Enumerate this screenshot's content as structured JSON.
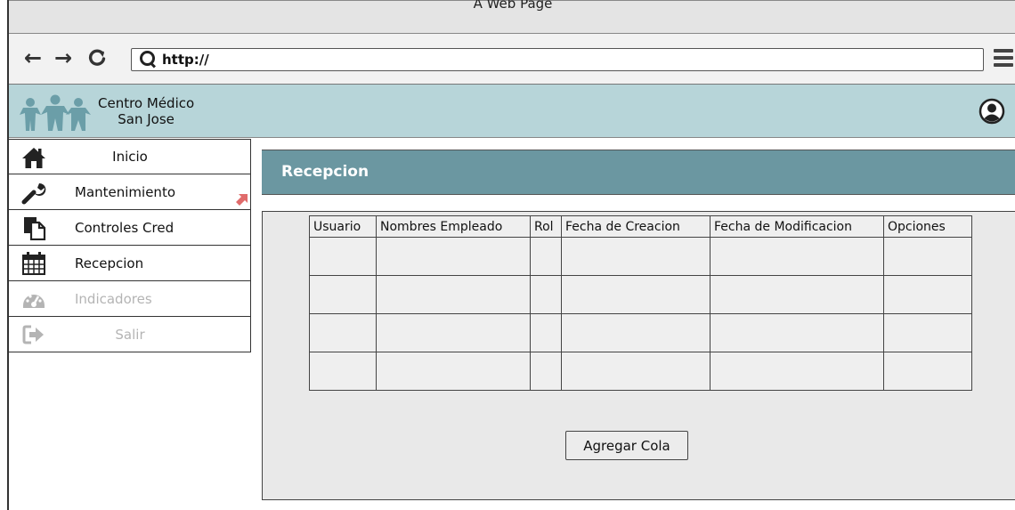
{
  "window": {
    "title": "A Web Page"
  },
  "addressbar": {
    "url": "http://",
    "icons": {
      "back": "back-arrow-icon",
      "forward": "forward-arrow-icon",
      "reload": "reload-icon",
      "search": "search-icon",
      "menu": "hamburger-menu-icon"
    }
  },
  "header": {
    "brand_line1": "Centro Médico",
    "brand_line2": "San Jose",
    "logo": "people-family-logo",
    "avatar": "user-avatar-icon",
    "background": "#b7d5d9"
  },
  "sidebar": {
    "items": [
      {
        "label": "Inicio",
        "icon": "home-icon",
        "enabled": true
      },
      {
        "label": "Mantenimiento",
        "icon": "wrench-icon",
        "enabled": true
      },
      {
        "label": "Controles Cred",
        "icon": "documents-icon",
        "enabled": true
      },
      {
        "label": "Recepcion",
        "icon": "calendar-icon",
        "enabled": true
      },
      {
        "label": "Indicadores",
        "icon": "gauge-icon",
        "enabled": false
      },
      {
        "label": "Salir",
        "icon": "sign-out-icon",
        "enabled": false
      }
    ]
  },
  "main": {
    "panel_title": "Recepcion",
    "panel_color": "#6b97a1",
    "table": {
      "columns": [
        "Usuario",
        "Nombres Empleado",
        "Rol",
        "Fecha de Creacion",
        "Fecha de Modificacion",
        "Opciones"
      ],
      "rows": [
        [
          "",
          "",
          "",
          "",
          "",
          ""
        ],
        [
          "",
          "",
          "",
          "",
          "",
          ""
        ],
        [
          "",
          "",
          "",
          "",
          "",
          ""
        ],
        [
          "",
          "",
          "",
          "",
          "",
          ""
        ]
      ]
    },
    "add_button_label": "Agregar Cola"
  }
}
